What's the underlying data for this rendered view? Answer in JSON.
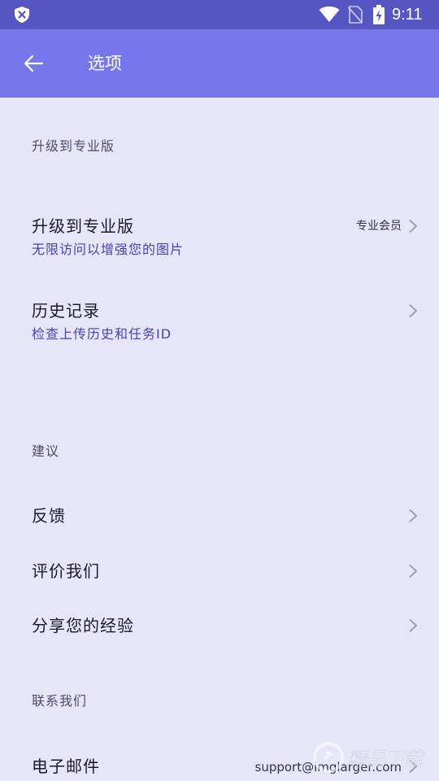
{
  "status_bar": {
    "time": "9:11"
  },
  "app_bar": {
    "title": "选项",
    "back_icon": "arrow-left-icon"
  },
  "sections": {
    "upgrade": {
      "header": "升级到专业版",
      "items": [
        {
          "label": "升级到专业版",
          "subtitle": "无限访问以增强您的图片",
          "value": "专业会员"
        },
        {
          "label": "历史记录",
          "subtitle": "检查上传历史和任务ID"
        }
      ]
    },
    "suggestions": {
      "header": "建议",
      "items": [
        {
          "label": "反馈"
        },
        {
          "label": "评价我们"
        },
        {
          "label": "分享您的经验"
        }
      ]
    },
    "contact": {
      "header": "联系我们",
      "items": [
        {
          "label": "电子邮件",
          "value": "support@imglarger.com"
        }
      ]
    }
  },
  "watermark": {
    "text": "精品下载"
  },
  "colors": {
    "status_bar": "#5656C2",
    "app_bar": "#7577EA",
    "background": "#E7E6F9",
    "subtitle": "#4346A8"
  }
}
